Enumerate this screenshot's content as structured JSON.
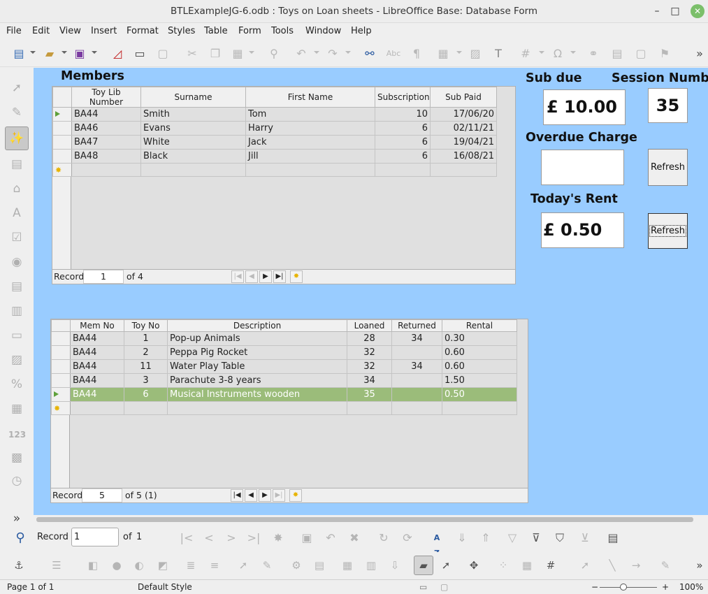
{
  "window": {
    "title": "BTLExampleJG-6.odb : Toys on Loan sheets - LibreOffice Base: Database Form",
    "minimize": "–",
    "maximize": "□",
    "close": "✕"
  },
  "menu": [
    "File",
    "Edit",
    "View",
    "Insert",
    "Format",
    "Styles",
    "Table",
    "Form",
    "Tools",
    "Window",
    "Help"
  ],
  "members_form": {
    "heading": "Members",
    "columns": [
      "Toy Lib Number",
      "Surname",
      "First Name",
      "Subscription",
      "Sub Paid"
    ],
    "rows": [
      [
        "BA44",
        "Smith",
        "Tom",
        "10",
        "17/06/20"
      ],
      [
        "BA46",
        "Evans",
        "Harry",
        "6",
        "02/11/21"
      ],
      [
        "BA47",
        "White",
        "Jack",
        "6",
        "19/04/21"
      ],
      [
        "BA48",
        "Black",
        "Jill",
        "6",
        "16/08/21"
      ]
    ],
    "nav": {
      "record_label": "Record",
      "record_value": "1",
      "of_text": "of 4"
    }
  },
  "side_panel": {
    "sub_due_label": "Sub due",
    "sub_due_value": "£ 10.00",
    "session_label": "Session  Number",
    "session_value": "35",
    "overdue_label": "Overdue Charge",
    "overdue_value": "",
    "refresh_label": "Refresh",
    "todays_rent_label": "Today's Rent",
    "todays_rent_value": "£ 0.50",
    "refresh2_label": "Refresh"
  },
  "loans_form": {
    "columns": [
      "Mem No",
      "Toy No",
      "Description",
      "Loaned",
      "Returned",
      "Rental"
    ],
    "rows": [
      [
        "BA44",
        "1",
        "Pop-up Animals",
        "28",
        "34",
        "0.30"
      ],
      [
        "BA44",
        "2",
        "Peppa Pig Rocket",
        "32",
        "",
        "0.60"
      ],
      [
        "BA44",
        "11",
        "Water Play Table",
        "32",
        "34",
        "0.60"
      ],
      [
        "BA44",
        "3",
        "Parachute 3-8 years",
        "34",
        "",
        "1.50"
      ],
      [
        "BA44",
        "6",
        "Musical Instruments wooden",
        "35",
        "",
        "0.50"
      ]
    ],
    "current_row": 4,
    "nav": {
      "record_label": "Record",
      "record_value": "5",
      "of_text": "of 5 (1)"
    }
  },
  "form_nav_toolbar": {
    "record_label": "Record",
    "record_value": "1",
    "of_label": "of",
    "of_value": "1"
  },
  "status": {
    "page": "Page 1 of 1",
    "style": "Default Style",
    "zoom": "100%"
  },
  "left_toolbar_extra": {
    "numeric_label": "123",
    "more": "»"
  },
  "colors": {
    "canvas": "#99ccff",
    "current_row": "#9bbc7a",
    "close_button": "#7bbf6a"
  }
}
